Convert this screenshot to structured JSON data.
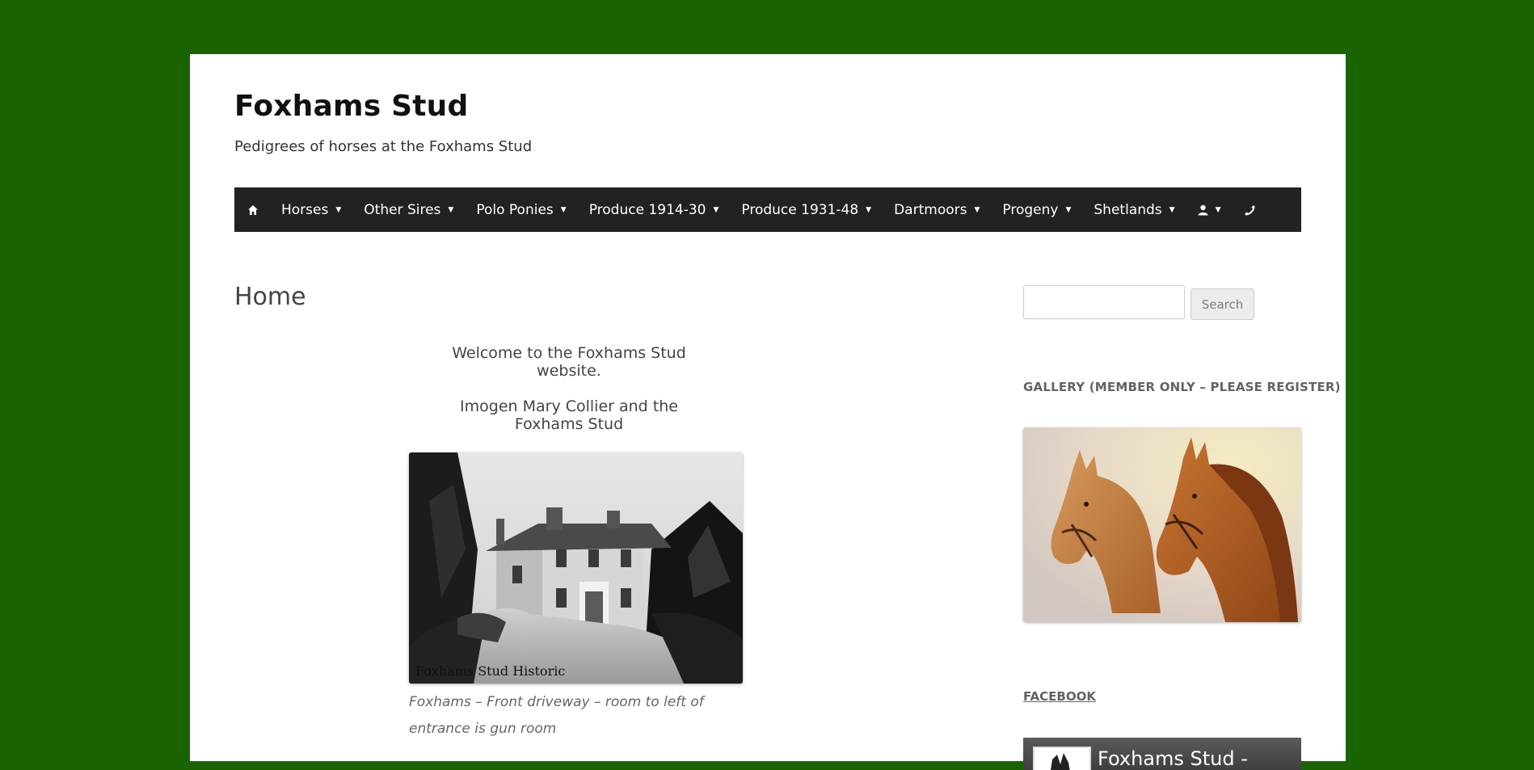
{
  "site": {
    "title": "Foxhams Stud",
    "description": "Pedigrees of horses at the Foxhams Stud"
  },
  "nav": {
    "items": [
      {
        "label": "Horses"
      },
      {
        "label": "Other Sires"
      },
      {
        "label": "Polo Ponies"
      },
      {
        "label": "Produce 1914-30"
      },
      {
        "label": "Produce 1931-48"
      },
      {
        "label": "Dartmoors"
      },
      {
        "label": "Progeny"
      },
      {
        "label": "Shetlands"
      }
    ],
    "icons": [
      "home-icon",
      "user-icon",
      "phone-icon"
    ]
  },
  "main": {
    "heading": "Home",
    "welcome": "Welcome to the Foxhams Stud website.",
    "subtitle": "Imogen Mary Collier and the Foxhams Stud",
    "photo_label": "Foxhams Stud Historic",
    "caption": "Foxhams – Front driveway – room to left of entrance is gun room"
  },
  "sidebar": {
    "search_placeholder": "",
    "search_button": "Search",
    "gallery_title": "GALLERY (MEMBER ONLY – PLEASE REGISTER)",
    "facebook_title": "FACEBOOK",
    "facebook_page_name": "Foxhams Stud -"
  },
  "colors": {
    "background": "#1a6400",
    "nav_bg": "#222222",
    "page_bg": "#ffffff"
  }
}
